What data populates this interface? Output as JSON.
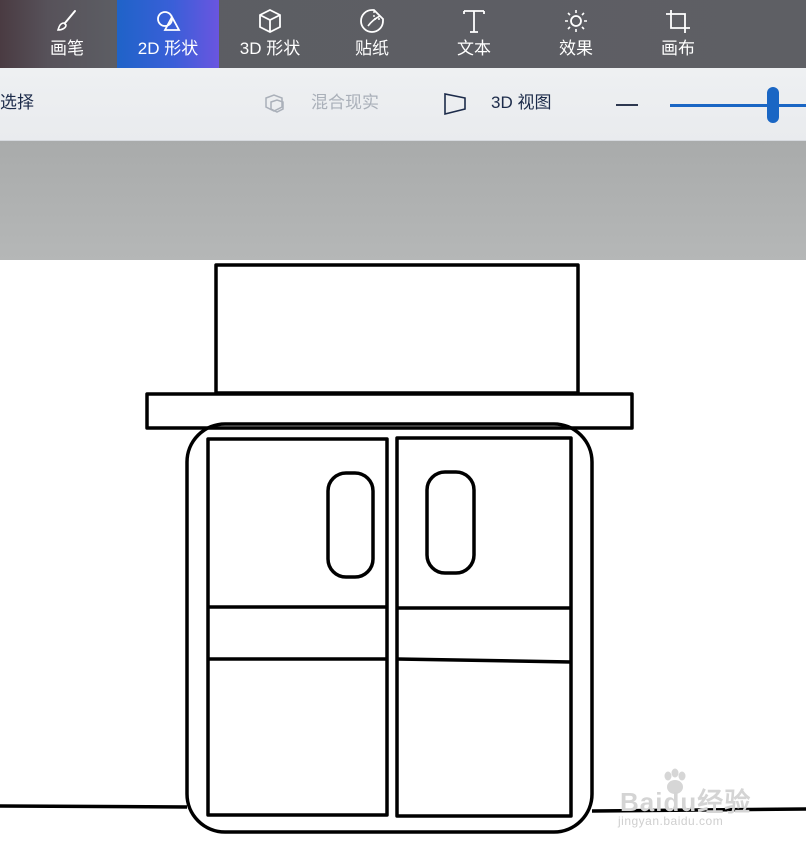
{
  "toolbar": {
    "tools": [
      {
        "label": "画笔",
        "icon": "brush-icon"
      },
      {
        "label": "2D 形状",
        "icon": "shapes-2d-icon",
        "active": true
      },
      {
        "label": "3D 形状",
        "icon": "cube-icon"
      },
      {
        "label": "贴纸",
        "icon": "sticker-icon"
      },
      {
        "label": "文本",
        "icon": "text-icon"
      },
      {
        "label": "效果",
        "icon": "sun-icon"
      },
      {
        "label": "画布",
        "icon": "crop-icon"
      }
    ],
    "active_color": "#3a5fd8"
  },
  "subbar": {
    "select_label": "选择",
    "mixed_reality_label": "混合现实",
    "view_3d_label": "3D 视图"
  },
  "watermark": {
    "brand": "Baidu经验",
    "url": "jingyan.baidu.com"
  }
}
